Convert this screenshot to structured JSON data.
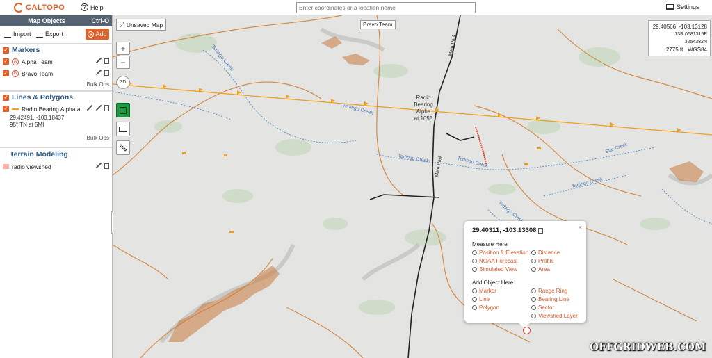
{
  "header": {
    "logo_text": "CALTOPO",
    "help_label": "Help",
    "search_placeholder": "Enter coordinates or a location name",
    "settings_label": "Settings"
  },
  "sidebar": {
    "title": "Map Objects",
    "shortcut": "Ctrl-O",
    "import_label": "Import",
    "export_label": "Export",
    "add_label": "Add",
    "markers": {
      "title": "Markers",
      "items": [
        {
          "badge": "A",
          "label": "Alpha Team"
        },
        {
          "badge": "B",
          "label": "Bravo Team"
        }
      ],
      "bulk_label": "Bulk Ops"
    },
    "lines": {
      "title": "Lines & Polygons",
      "item_label": "Radio Bearing Alpha at...",
      "coords": "29.42491, -103.18437",
      "bearing": "95° TN at 5MI",
      "bulk_label": "Bulk Ops"
    },
    "terrain": {
      "title": "Terrain Modeling",
      "item_label": "radio viewshed"
    }
  },
  "map": {
    "unsaved_label": "Unsaved Map",
    "bravo_label": "Bravo Team",
    "radio_label_lines": [
      "Radio",
      "Bearing",
      "Alpha",
      "at 1055"
    ],
    "road_labels": [
      "Main Park",
      "Main Park"
    ],
    "creeks": [
      "Terlingo Creek",
      "Terlingo Creek",
      "Terlingo Creek",
      "Terlingo Creek",
      "Star Creek",
      "Terlingo Creek",
      "Terlingo Creek"
    ],
    "coords": {
      "latlon": "29.40566, -103.13128",
      "utm": "13R 0681315E 3254382N",
      "elev": "2775 ft",
      "datum": "WGS84"
    },
    "watermark": "OFFGRIDWEB.COM"
  },
  "popup": {
    "title": "29.40311, -103.13308",
    "close": "×",
    "measure_header": "Measure Here",
    "measure_links": [
      [
        "Position & Elevation",
        "Distance"
      ],
      [
        "NOAA Forecast",
        "Profile"
      ],
      [
        "Simulated View",
        "Area"
      ]
    ],
    "add_header": "Add Object Here",
    "add_links": [
      [
        "Marker",
        "Range Ring"
      ],
      [
        "Line",
        "Bearing Line"
      ],
      [
        "Polygon",
        "Sector"
      ],
      [
        "",
        "Viewshed Layer"
      ]
    ]
  },
  "colors": {
    "accent": "#e0612a",
    "sidebar_header": "#556373",
    "bearing_line": "#f0a020",
    "link_blue": "#2d5886"
  }
}
